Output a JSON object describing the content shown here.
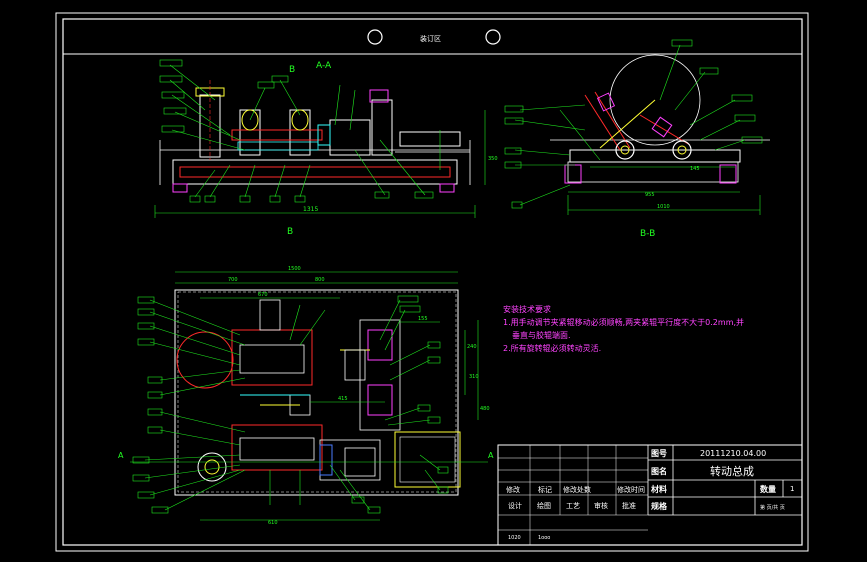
{
  "header": {
    "stamp_text": "装订区"
  },
  "views": {
    "section_aa": "A-A",
    "section_bb": "B-B",
    "marker_b_top": "B",
    "marker_b_bottom": "B",
    "marker_a_left": "A",
    "marker_a_right": "A"
  },
  "dimensions": {
    "front_total": "1315",
    "front_height": "350",
    "side_total": "1010",
    "side_inner": "955",
    "side_sub": "145",
    "plan_total": "1500",
    "plan_left": "700",
    "plan_right": "800",
    "plan_inner": "670",
    "plan_mid": "415",
    "plan_sub": "155",
    "plan_side_1": "240",
    "plan_side_2": "310",
    "plan_side_3": "480",
    "plan_bottom": "610"
  },
  "notes": {
    "title": "安装技术要求",
    "line1": "1.用手动调节夹紧辊移动必须顺畅,两夹紧辊平行度不大于0.2mm,并",
    "line2": "垂直与胶辊端面.",
    "line3": "2.所有旋转辊必须转动灵活."
  },
  "title_block": {
    "drawing_no_label": "图号",
    "drawing_no": "20111210.04.00",
    "name_label": "图名",
    "name": "转动总成",
    "material_label": "材料",
    "quantity_label": "数量",
    "quantity": "1",
    "spec_label": "规格",
    "sheet": "第 页/共 页",
    "rev_cols": [
      "修改",
      "标记",
      "修改处数",
      "修改时间"
    ],
    "sign_cols": [
      "设计",
      "绘图",
      "工艺",
      "审核",
      "批准"
    ],
    "bottom_left": "1020",
    "bottom_mid": "1ooo"
  }
}
